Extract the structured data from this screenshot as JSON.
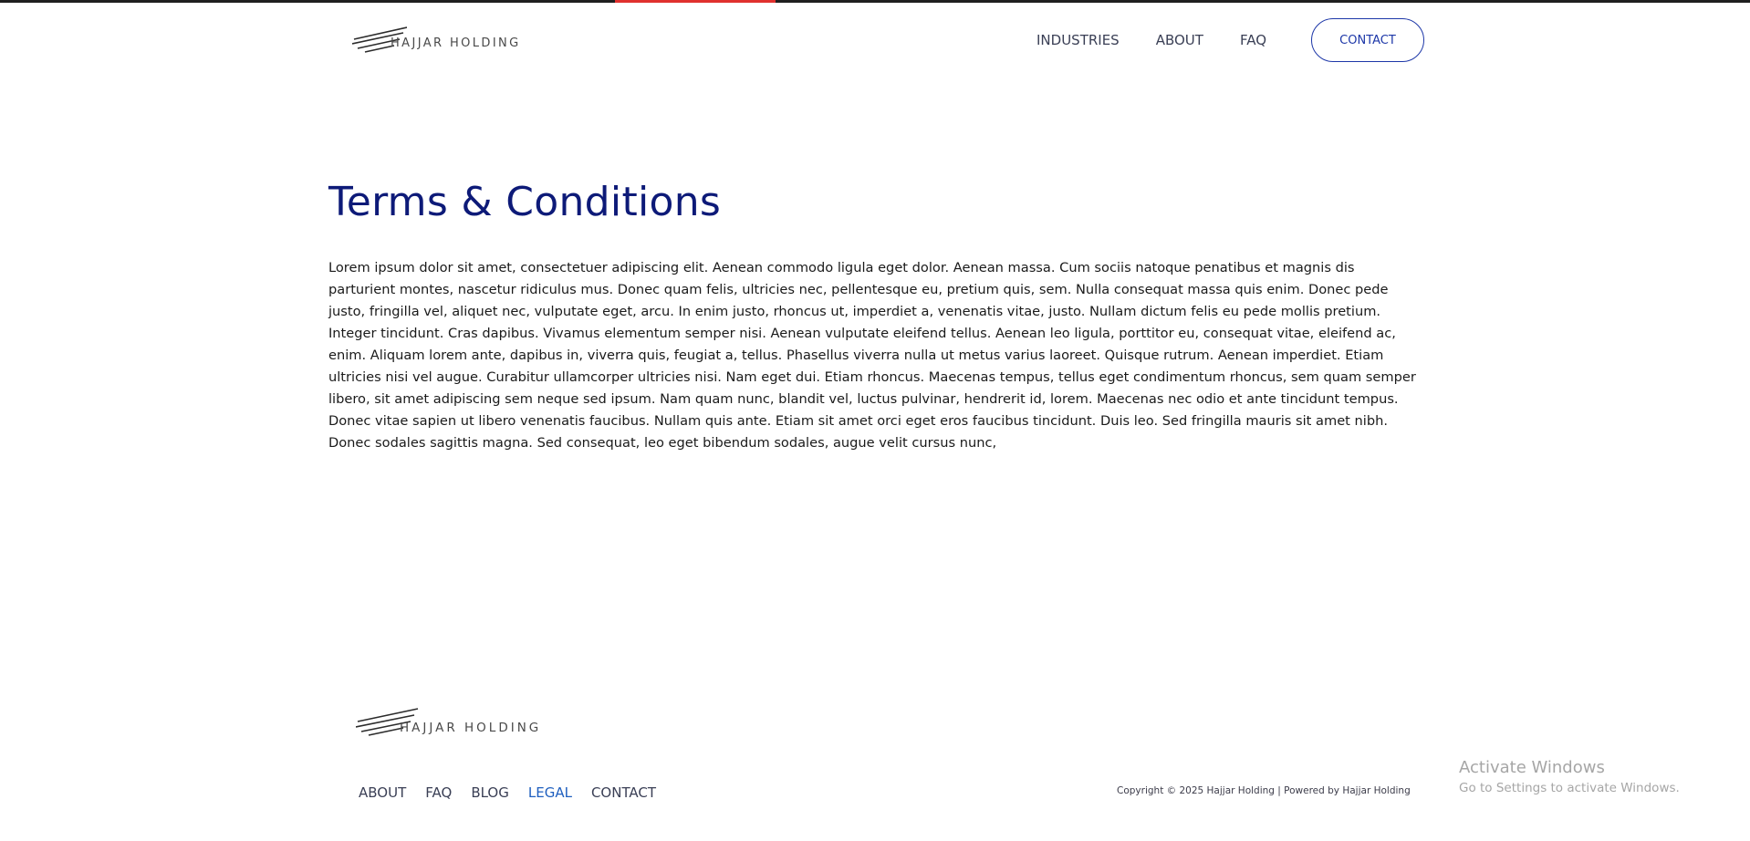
{
  "brand": {
    "name": "HAJJAR HOLDING",
    "logo_icon": "slash-lines-logo",
    "colors": {
      "primary": "#0d1a78",
      "accent_top": "#e0312e",
      "button_border": "#1d37a8",
      "active_link": "#1f5fbf"
    }
  },
  "header": {
    "nav": [
      {
        "label": "INDUSTRIES"
      },
      {
        "label": "ABOUT"
      },
      {
        "label": "FAQ"
      }
    ],
    "contact_label": "CONTACT"
  },
  "main": {
    "title": "Terms & Conditions",
    "body": "Lorem ipsum dolor sit amet, consectetuer adipiscing elit. Aenean commodo ligula eget dolor. Aenean massa. Cum sociis natoque penatibus et magnis dis parturient montes, nascetur ridiculus mus. Donec quam felis, ultricies nec, pellentesque eu, pretium quis, sem. Nulla consequat massa quis enim. Donec pede justo, fringilla vel, aliquet nec, vulputate eget, arcu. In enim justo, rhoncus ut, imperdiet a, venenatis vitae, justo. Nullam dictum felis eu pede mollis pretium. Integer tincidunt. Cras dapibus. Vivamus elementum semper nisi. Aenean vulputate eleifend tellus. Aenean leo ligula, porttitor eu, consequat vitae, eleifend ac, enim. Aliquam lorem ante, dapibus in, viverra quis, feugiat a, tellus. Phasellus viverra nulla ut metus varius laoreet. Quisque rutrum. Aenean imperdiet. Etiam ultricies nisi vel augue. Curabitur ullamcorper ultricies nisi. Nam eget dui. Etiam rhoncus. Maecenas tempus, tellus eget condimentum rhoncus, sem quam semper libero, sit amet adipiscing sem neque sed ipsum. Nam quam nunc, blandit vel, luctus pulvinar, hendrerit id, lorem. Maecenas nec odio et ante tincidunt tempus. Donec vitae sapien ut libero venenatis faucibus. Nullam quis ante. Etiam sit amet orci eget eros faucibus tincidunt. Duis leo. Sed fringilla mauris sit amet nibh. Donec sodales sagittis magna. Sed consequat, leo eget bibendum sodales, augue velit cursus nunc,"
  },
  "footer": {
    "links": [
      {
        "label": "ABOUT",
        "active": false
      },
      {
        "label": "FAQ",
        "active": false
      },
      {
        "label": "BLOG",
        "active": false
      },
      {
        "label": "LEGAL",
        "active": true
      },
      {
        "label": "CONTACT",
        "active": false
      }
    ],
    "copyright": "Copyright © 2025 Hajjar Holding | Powered by Hajjar Holding"
  },
  "os_watermark": {
    "title": "Activate Windows",
    "subtitle": "Go to Settings to activate Windows."
  }
}
